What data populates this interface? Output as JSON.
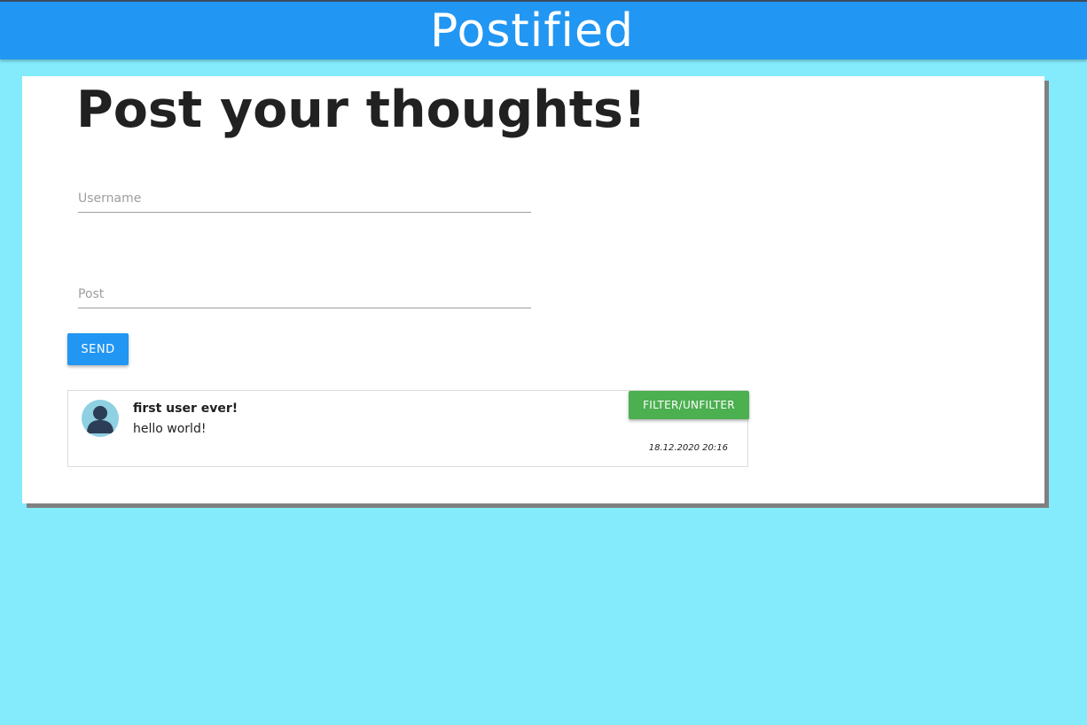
{
  "header": {
    "brand": "Postified",
    "brand_color": "#2196F3"
  },
  "form": {
    "heading": "Post your thoughts!",
    "username_placeholder": "Username",
    "username_value": "",
    "post_placeholder": "Post",
    "post_value": "",
    "send_label": "SEND",
    "send_color": "#2196F3"
  },
  "posts": [
    {
      "avatar_icon": "user-avatar-icon",
      "username": "first user ever!",
      "text": "hello world!",
      "timestamp": "18.12.2020 20:16",
      "filter_label": "FILTER/UNFILTER",
      "filter_color": "#4CAF50"
    }
  ],
  "background_color": "#84EBFC"
}
